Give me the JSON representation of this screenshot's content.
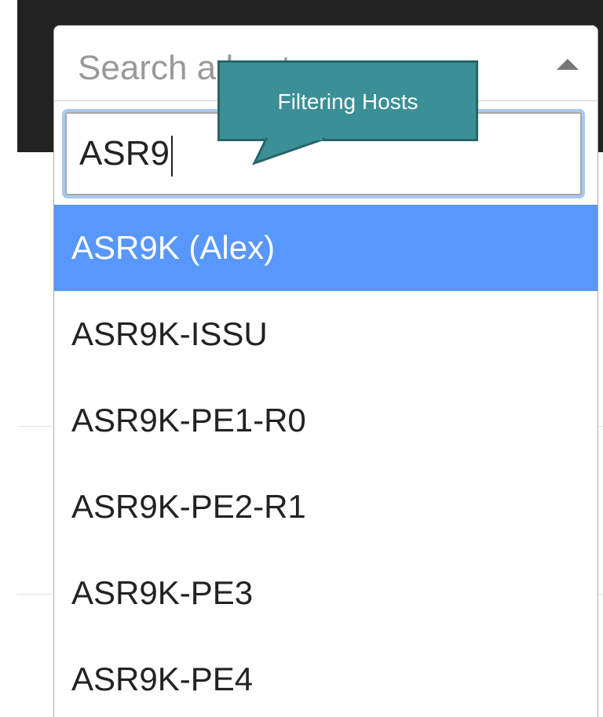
{
  "host_select": {
    "placeholder": "Search a host",
    "search_value": "ASR9",
    "results": [
      {
        "label": "ASR9K (Alex)",
        "highlighted": true
      },
      {
        "label": "ASR9K-ISSU",
        "highlighted": false
      },
      {
        "label": "ASR9K-PE1-R0",
        "highlighted": false
      },
      {
        "label": "ASR9K-PE2-R1",
        "highlighted": false
      },
      {
        "label": "ASR9K-PE3",
        "highlighted": false
      },
      {
        "label": "ASR9K-PE4",
        "highlighted": false
      }
    ]
  },
  "tooltip": {
    "text": "Filtering Hosts"
  },
  "colors": {
    "highlight": "#5897fb",
    "tooltip_fill": "#3b8f96",
    "tooltip_border": "#27646a",
    "header_background": "#222222"
  },
  "icons": {
    "dropdown_arrow": "triangle-up-icon"
  }
}
